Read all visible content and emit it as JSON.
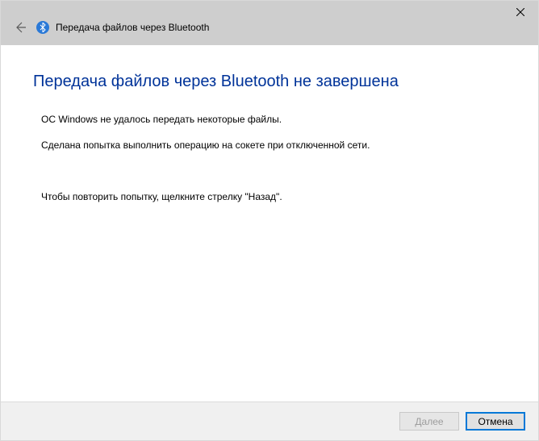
{
  "titlebar": {
    "title": "Передача файлов через Bluetooth"
  },
  "content": {
    "heading": "Передача файлов через Bluetooth не завершена",
    "message1": "ОС Windows не удалось передать некоторые файлы.",
    "message2": "Сделана попытка выполнить операцию на сокете при отключенной сети.",
    "message3": "Чтобы повторить попытку, щелкните стрелку \"Назад\"."
  },
  "footer": {
    "next_label": "Далее",
    "cancel_label": "Отмена"
  }
}
